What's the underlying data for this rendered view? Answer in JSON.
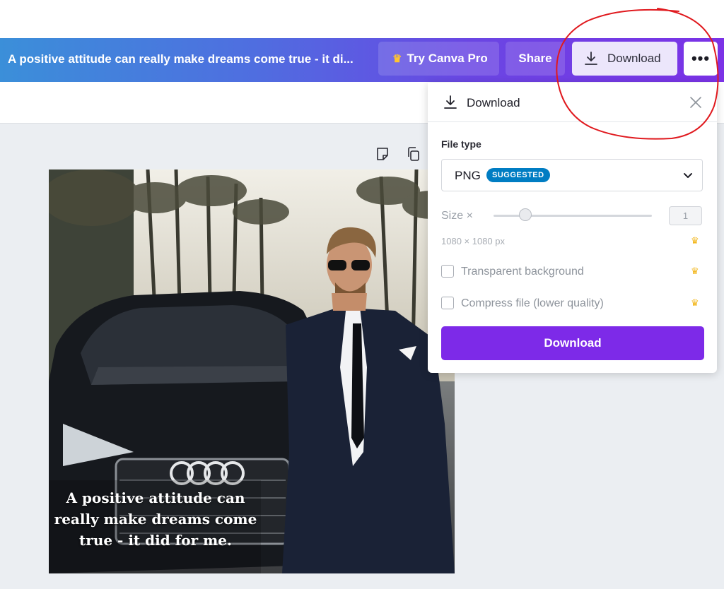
{
  "header": {
    "doc_title": "A positive attitude can really make dreams come true - it di...",
    "try_pro_label": "Try Canva Pro",
    "share_label": "Share",
    "download_label": "Download",
    "more_label": "•••",
    "crown_glyph": "♛",
    "gradient_start": "#3b8fd9",
    "gradient_end": "#7b32e6"
  },
  "design": {
    "quote_lines": [
      "A positive attitude can",
      "really make dreams come",
      "true - it did for me."
    ]
  },
  "download_panel": {
    "title": "Download",
    "file_type_label": "File type",
    "file_type_value": "PNG",
    "suggested_badge": "SUGGESTED",
    "size_label": "Size ×",
    "size_value": "1",
    "size_slider_fraction": 0.2,
    "dimensions": "1080 × 1080 px",
    "transparent_label": "Transparent background",
    "transparent_checked": false,
    "compress_label": "Compress file (lower quality)",
    "compress_checked": false,
    "download_button_label": "Download",
    "button_color": "#7d2ae8",
    "pro_crown_color": "#f2b414"
  }
}
